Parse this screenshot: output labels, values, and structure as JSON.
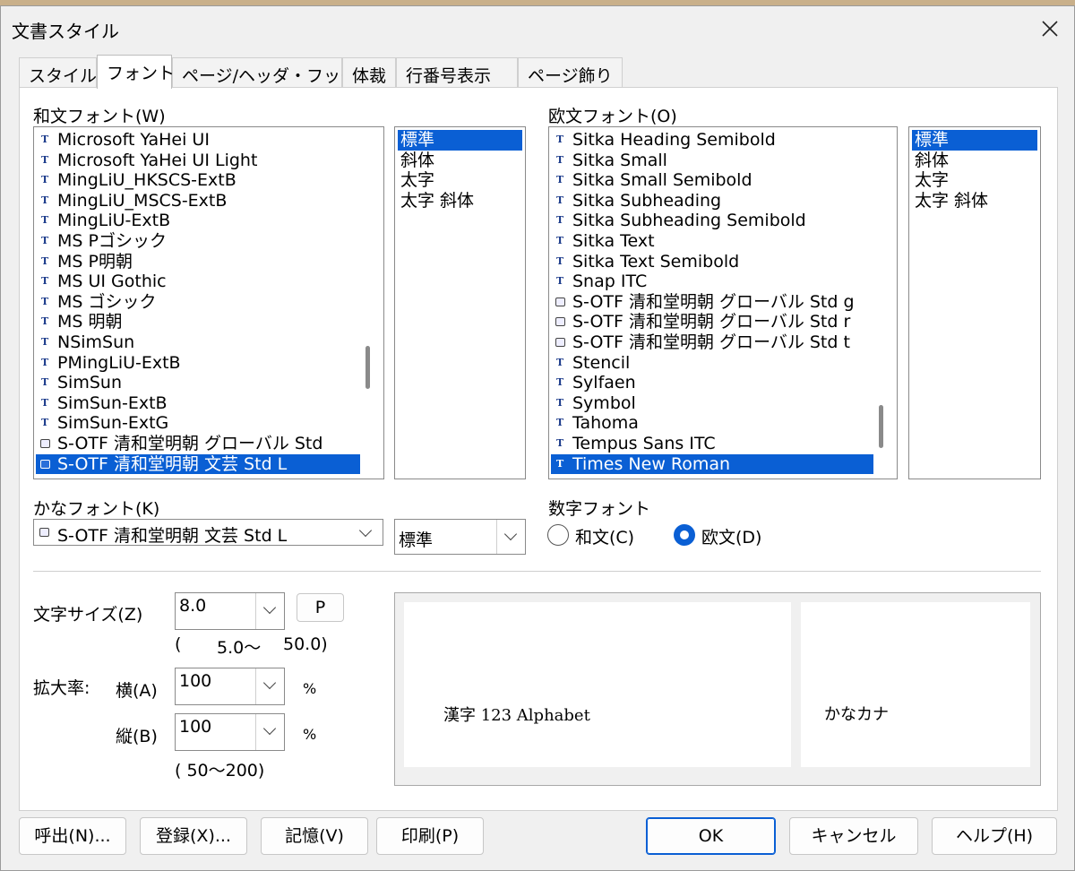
{
  "window": {
    "title": "文書スタイル"
  },
  "tabs": [
    {
      "label": "スタイル"
    },
    {
      "label": "フォント"
    },
    {
      "label": "ページ/ヘッダ・フッタ"
    },
    {
      "label": "体裁"
    },
    {
      "label": "行番号表示"
    },
    {
      "label": "ページ飾り"
    }
  ],
  "wafont": {
    "label": "和文フォント(W)",
    "fonts": [
      {
        "icon": "truetype-icon",
        "name": "Microsoft YaHei UI"
      },
      {
        "icon": "truetype-icon",
        "name": "Microsoft YaHei UI Light"
      },
      {
        "icon": "truetype-icon",
        "name": "MingLiU_HKSCS-ExtB"
      },
      {
        "icon": "truetype-icon",
        "name": "MingLiU_MSCS-ExtB"
      },
      {
        "icon": "truetype-icon",
        "name": "MingLiU-ExtB"
      },
      {
        "icon": "truetype-icon",
        "name": "MS Pゴシック"
      },
      {
        "icon": "truetype-icon",
        "name": "MS P明朝"
      },
      {
        "icon": "truetype-icon",
        "name": "MS UI Gothic"
      },
      {
        "icon": "truetype-icon",
        "name": "MS ゴシック"
      },
      {
        "icon": "truetype-icon",
        "name": "MS 明朝"
      },
      {
        "icon": "truetype-icon",
        "name": "NSimSun"
      },
      {
        "icon": "truetype-icon",
        "name": "PMingLiU-ExtB"
      },
      {
        "icon": "truetype-icon",
        "name": "SimSun"
      },
      {
        "icon": "truetype-icon",
        "name": "SimSun-ExtB"
      },
      {
        "icon": "truetype-icon",
        "name": "SimSun-ExtG"
      },
      {
        "icon": "printer-font-icon",
        "name": "S-OTF 清和堂明朝 グローバル Std"
      },
      {
        "icon": "printer-font-icon",
        "name": "S-OTF 清和堂明朝 文芸 Std L",
        "selected": true
      }
    ],
    "styles": [
      {
        "name": "標準",
        "selected": true
      },
      {
        "name": "斜体"
      },
      {
        "name": "太字"
      },
      {
        "name": "太字 斜体"
      }
    ]
  },
  "oubun": {
    "label": "欧文フォント(O)",
    "fonts": [
      {
        "icon": "truetype-icon",
        "name": "Sitka Heading Semibold"
      },
      {
        "icon": "truetype-icon",
        "name": "Sitka Small"
      },
      {
        "icon": "truetype-icon",
        "name": "Sitka Small Semibold"
      },
      {
        "icon": "truetype-icon",
        "name": "Sitka Subheading"
      },
      {
        "icon": "truetype-icon",
        "name": "Sitka Subheading Semibold"
      },
      {
        "icon": "truetype-icon",
        "name": "Sitka Text"
      },
      {
        "icon": "truetype-icon",
        "name": "Sitka Text Semibold"
      },
      {
        "icon": "truetype-icon",
        "name": "Snap ITC"
      },
      {
        "icon": "printer-font-icon",
        "name": "S-OTF 清和堂明朝 グローバル Std g"
      },
      {
        "icon": "printer-font-icon",
        "name": "S-OTF 清和堂明朝 グローバル Std r"
      },
      {
        "icon": "printer-font-icon",
        "name": "S-OTF 清和堂明朝 グローバル Std t"
      },
      {
        "icon": "truetype-icon",
        "name": "Stencil"
      },
      {
        "icon": "truetype-icon",
        "name": "Sylfaen"
      },
      {
        "icon": "truetype-icon",
        "name": "Symbol"
      },
      {
        "icon": "truetype-icon",
        "name": "Tahoma"
      },
      {
        "icon": "truetype-icon",
        "name": "Tempus Sans ITC"
      },
      {
        "icon": "truetype-icon",
        "name": "Times New Roman",
        "selected": true
      }
    ],
    "styles": [
      {
        "name": "標準",
        "selected": true
      },
      {
        "name": "斜体"
      },
      {
        "name": "太字"
      },
      {
        "name": "太字 斜体"
      }
    ]
  },
  "kana": {
    "label": "かなフォント(K)",
    "value": "S-OTF 清和堂明朝 文芸 Std L",
    "style_value": "標準"
  },
  "digit_font": {
    "label": "数字フォント",
    "options": [
      {
        "label": "和文(C)",
        "checked": false
      },
      {
        "label": "欧文(D)",
        "checked": true
      }
    ]
  },
  "size": {
    "label": "文字サイズ(Z)",
    "value": "8.0",
    "p_button": "P",
    "range_open": "(",
    "range_text": "5.0〜",
    "range_close": "50.0)"
  },
  "scale": {
    "label": "拡大率:",
    "horizontal_label": "横(A)",
    "horizontal_value": "100",
    "vertical_label": "縦(B)",
    "vertical_value": "100",
    "unit": "%",
    "range_text": "( 50〜200)"
  },
  "preview": {
    "text_main": "漢字 123 Alphabet",
    "text_kana": "かなカナ"
  },
  "buttons": {
    "call": "呼出(N)...",
    "register": "登録(X)...",
    "memory": "記憶(V)",
    "print": "印刷(P)",
    "ok": "OK",
    "cancel": "キャンセル",
    "help": "ヘルプ(H)"
  },
  "colors": {
    "selection": "#0a5fd4",
    "dialog_bg": "#f0f0f0",
    "panel_bg": "#ffffff"
  }
}
